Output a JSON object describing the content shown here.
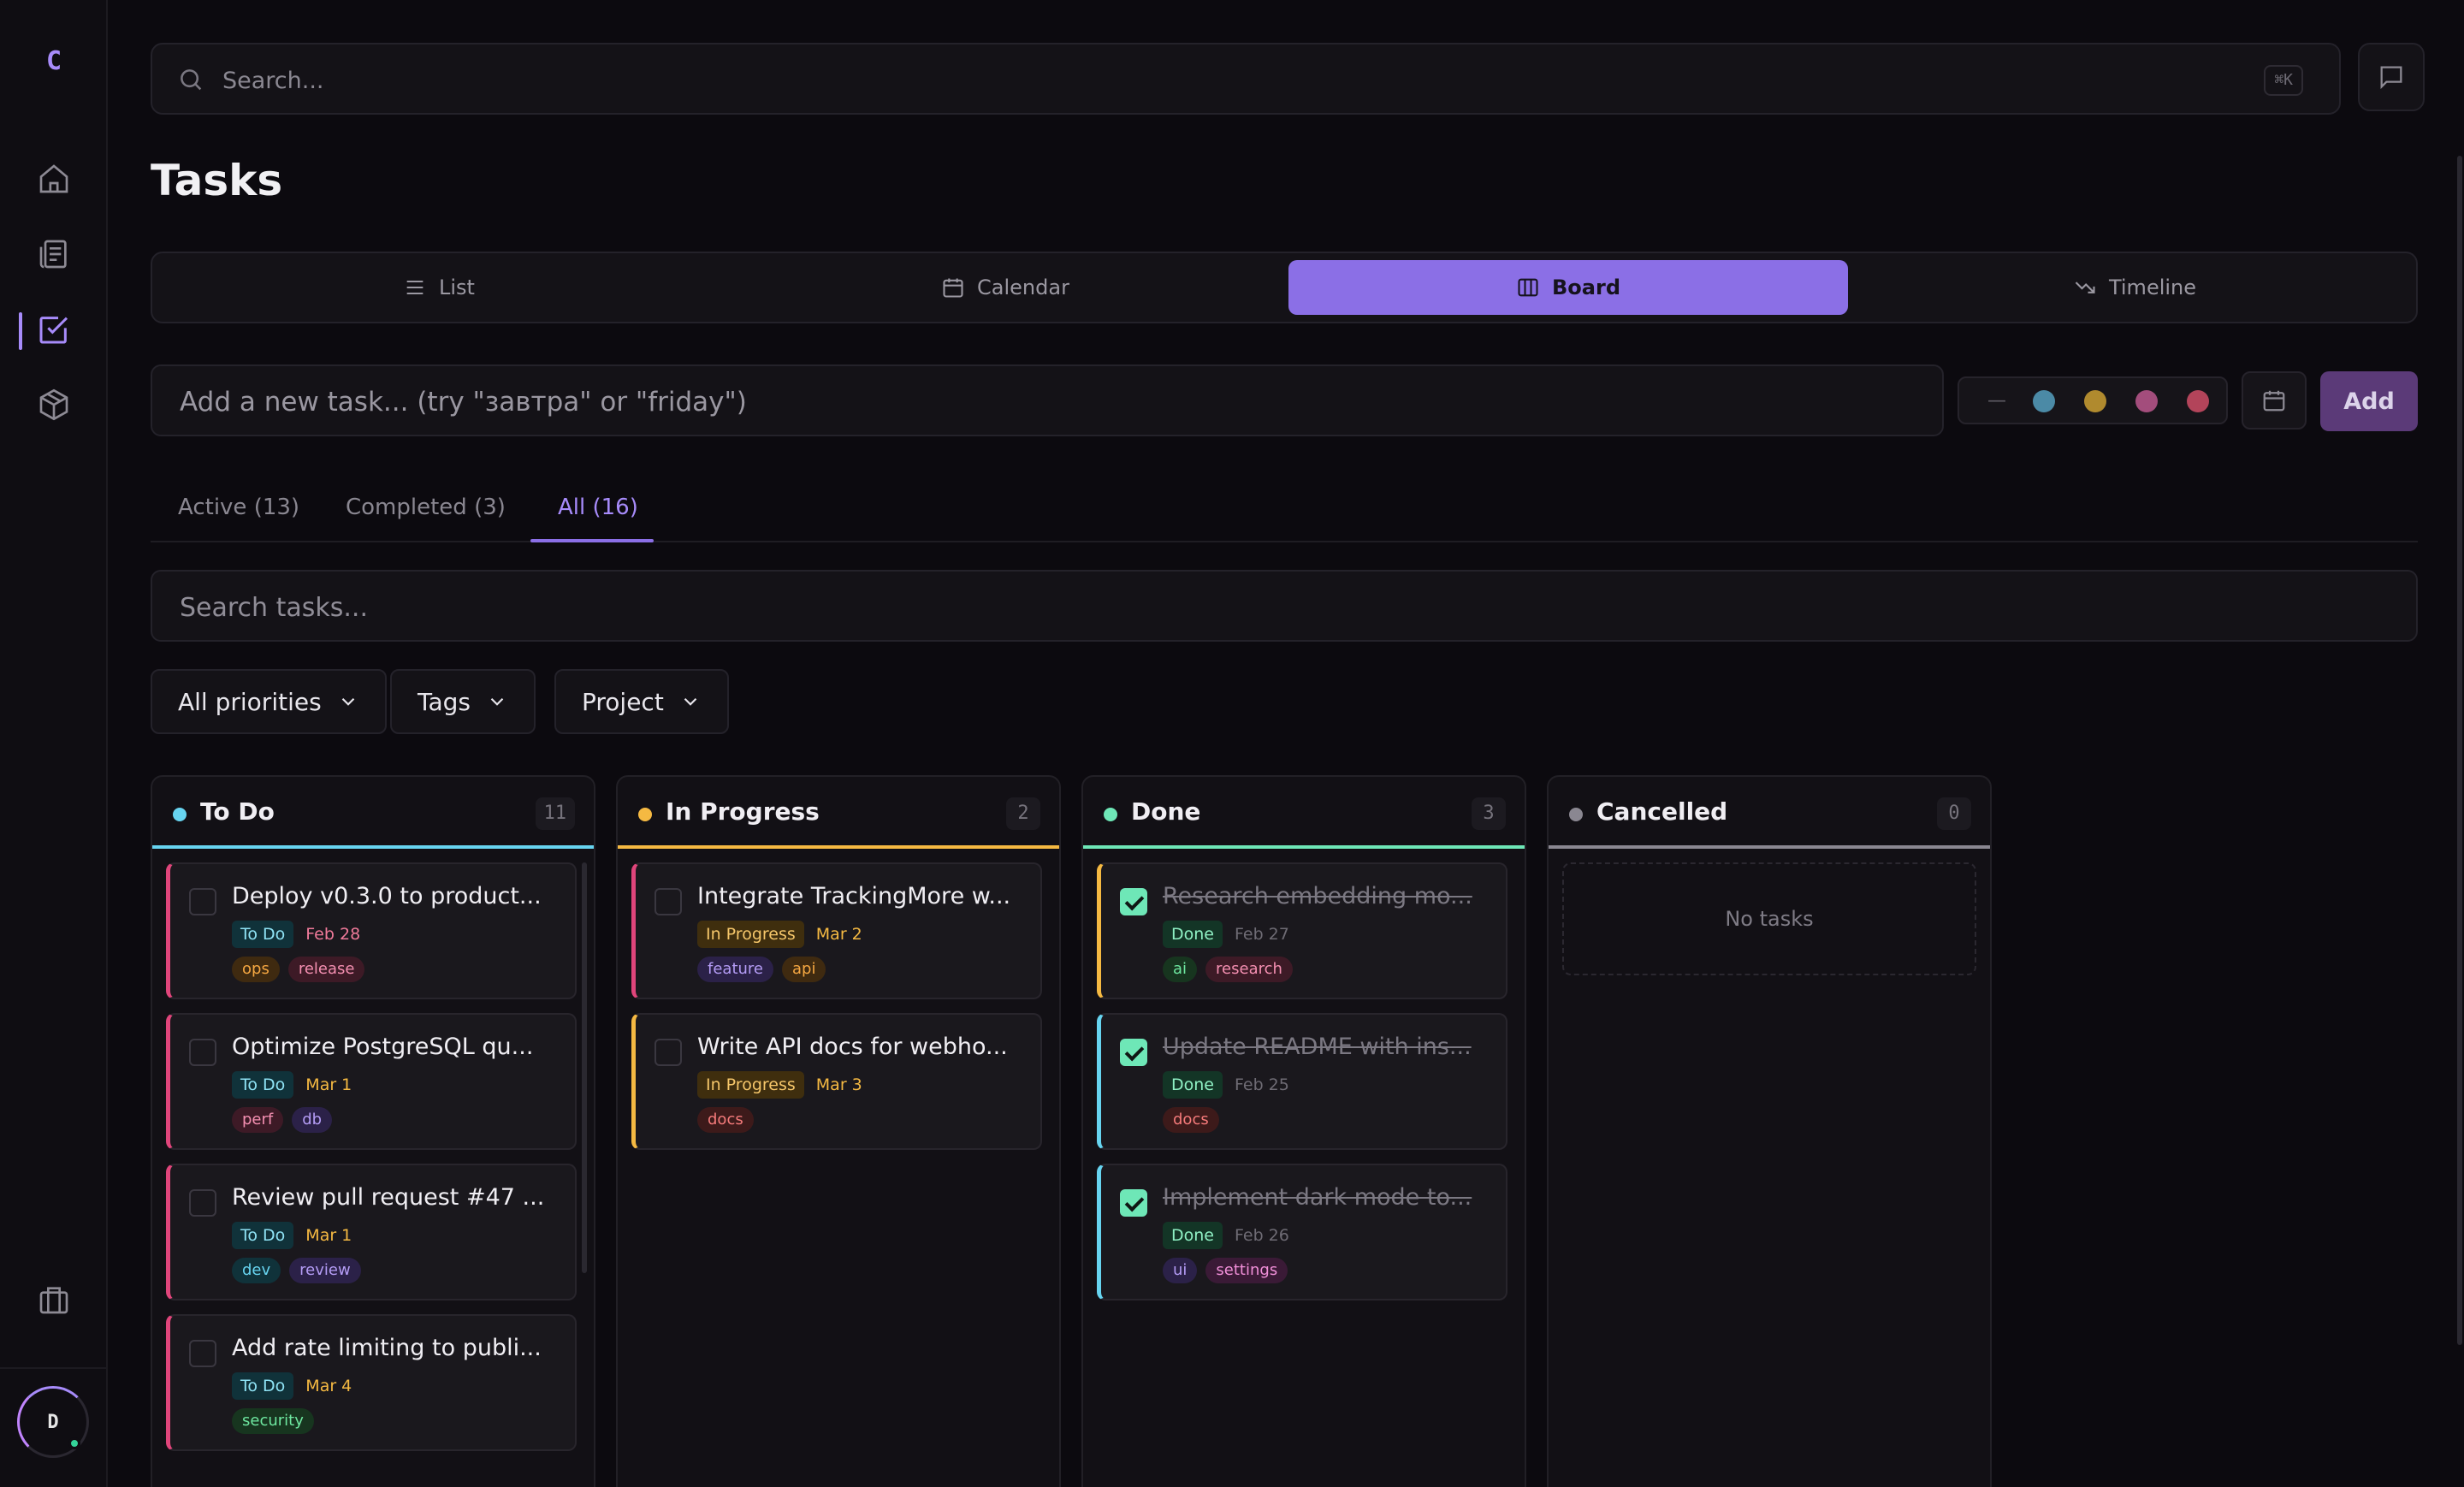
{
  "sidebar": {
    "logo": "C",
    "nav": [
      {
        "name": "home-icon"
      },
      {
        "name": "notes-icon"
      },
      {
        "name": "tasks-icon",
        "active": true
      },
      {
        "name": "package-icon"
      }
    ],
    "bottom_icon": "briefcase-icon",
    "avatar_initial": "D",
    "status_color": "#34d399"
  },
  "topbar": {
    "search_placeholder": "Search...",
    "shortcut": "⌘K"
  },
  "page": {
    "title": "Tasks"
  },
  "views": [
    {
      "label": "List",
      "icon": "list-icon"
    },
    {
      "label": "Calendar",
      "icon": "calendar-icon"
    },
    {
      "label": "Board",
      "icon": "board-icon",
      "active": true
    },
    {
      "label": "Timeline",
      "icon": "timeline-icon"
    }
  ],
  "add_task": {
    "placeholder": "Add a new task... (try \"завтра\" or \"friday\")",
    "priority_none": "—",
    "priority_colors": [
      "#4b8aa6",
      "#b08a2e",
      "#a34d7c",
      "#b3445a"
    ],
    "add_label": "Add"
  },
  "filter_tabs": [
    {
      "label": "Active (13)"
    },
    {
      "label": "Completed (3)"
    },
    {
      "label": "All (16)",
      "active": true
    }
  ],
  "task_search": {
    "placeholder": "Search tasks..."
  },
  "dropdowns": [
    {
      "label": "All priorities"
    },
    {
      "label": "Tags"
    },
    {
      "label": "Project"
    }
  ],
  "columns": [
    {
      "title": "To Do",
      "count": "11",
      "color": "#67d4f0",
      "cards": [
        {
          "title": "Deploy v0.3.0 to product...",
          "status": "To Do",
          "date": "Feb 28",
          "date_color": "#f07a9a",
          "accent": "#e0457b",
          "tags": [
            {
              "label": "ops",
              "bg": "#3f2a10",
              "fg": "#f5a742"
            },
            {
              "label": "release",
              "bg": "#3d1a26",
              "fg": "#f48fb1"
            }
          ]
        },
        {
          "title": "Optimize PostgreSQL qu...",
          "status": "To Do",
          "date": "Mar 1",
          "date_color": "#f5b942",
          "accent": "#e0457b",
          "tags": [
            {
              "label": "perf",
              "bg": "#3d1a26",
              "fg": "#f48fb1"
            },
            {
              "label": "db",
              "bg": "#2b2148",
              "fg": "#b49cf5"
            }
          ]
        },
        {
          "title": "Review pull request #47 ...",
          "status": "To Do",
          "date": "Mar 1",
          "date_color": "#f5b942",
          "accent": "#e0457b",
          "tags": [
            {
              "label": "dev",
              "bg": "#10323a",
              "fg": "#67d4f0"
            },
            {
              "label": "review",
              "bg": "#2b2148",
              "fg": "#b49cf5"
            }
          ]
        },
        {
          "title": "Add rate limiting to publi...",
          "status": "To Do",
          "date": "Mar 4",
          "date_color": "#f5b942",
          "accent": "#e0457b",
          "tags": [
            {
              "label": "security",
              "bg": "#17351f",
              "fg": "#6ee7a0"
            }
          ]
        }
      ]
    },
    {
      "title": "In Progress",
      "count": "2",
      "color": "#f5b942",
      "cards": [
        {
          "title": "Integrate TrackingMore w...",
          "status": "In Progress",
          "date": "Mar 2",
          "date_color": "#f5b942",
          "accent": "#e0457b",
          "tags": [
            {
              "label": "feature",
              "bg": "#2b2148",
              "fg": "#b49cf5"
            },
            {
              "label": "api",
              "bg": "#3f2a10",
              "fg": "#f5a742"
            }
          ]
        },
        {
          "title": "Write API docs for webho...",
          "status": "In Progress",
          "date": "Mar 3",
          "date_color": "#f5b942",
          "accent": "#f5b942",
          "tags": [
            {
              "label": "docs",
              "bg": "#3d1a1a",
              "fg": "#f47a7a"
            }
          ]
        }
      ]
    },
    {
      "title": "Done",
      "count": "3",
      "color": "#6ee7b7",
      "cards": [
        {
          "title": "Research embedding mo...",
          "status": "Done",
          "date": "Feb 27",
          "date_color": "#6e6b74",
          "accent": "#f5b942",
          "done": true,
          "tags": [
            {
              "label": "ai",
              "bg": "#17351f",
              "fg": "#6ee7a0"
            },
            {
              "label": "research",
              "bg": "#3d1a26",
              "fg": "#f48fb1"
            }
          ]
        },
        {
          "title": "Update README with ins...",
          "status": "Done",
          "date": "Feb 25",
          "date_color": "#6e6b74",
          "accent": "#67d4f0",
          "done": true,
          "tags": [
            {
              "label": "docs",
              "bg": "#3d1a1a",
              "fg": "#f47a7a"
            }
          ]
        },
        {
          "title": "Implement dark mode to...",
          "status": "Done",
          "date": "Feb 26",
          "date_color": "#6e6b74",
          "accent": "#67d4f0",
          "done": true,
          "tags": [
            {
              "label": "ui",
              "bg": "#2b2148",
              "fg": "#b49cf5"
            },
            {
              "label": "settings",
              "bg": "#3a1a36",
              "fg": "#f08fd8"
            }
          ]
        }
      ]
    },
    {
      "title": "Cancelled",
      "count": "0",
      "color": "#8a8791",
      "cards": [],
      "empty_label": "No tasks"
    }
  ],
  "status_styles": {
    "To Do": {
      "bg": "#10323a",
      "fg": "#8fe3f5"
    },
    "In Progress": {
      "bg": "#3f2e0e",
      "fg": "#f5c66a"
    },
    "Done": {
      "bg": "#133526",
      "fg": "#8ff0c4"
    }
  }
}
